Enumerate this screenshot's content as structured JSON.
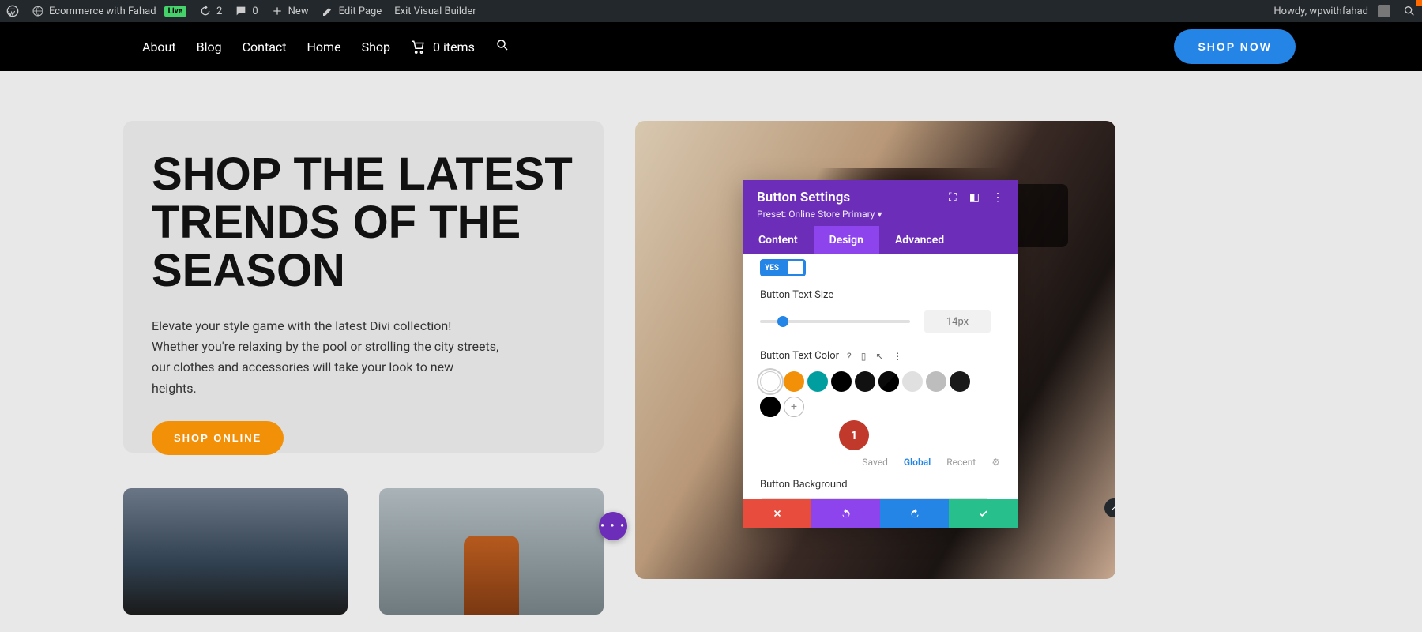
{
  "adminBar": {
    "siteName": "Ecommerce with Fahad",
    "liveBadge": "Live",
    "revisions": "2",
    "comments": "0",
    "newLabel": "New",
    "editPage": "Edit Page",
    "exitBuilder": "Exit Visual Builder",
    "howdy": "Howdy, wpwithfahad"
  },
  "nav": {
    "about": "About",
    "blog": "Blog",
    "contact": "Contact",
    "home": "Home",
    "shop": "Shop",
    "cartItems": "0 items",
    "shopNow": "SHOP NOW"
  },
  "hero": {
    "headline": "SHOP THE LATEST TRENDS OF THE SEASON",
    "body": "Elevate your style game with the latest Divi collection! Whether you're relaxing by the pool or strolling the city streets, our clothes and accessories will take your look to new heights.",
    "cta": "SHOP ONLINE"
  },
  "settings": {
    "title": "Button Settings",
    "preset": "Preset: Online Store Primary ▾",
    "tabs": {
      "content": "Content",
      "design": "Design",
      "advanced": "Advanced"
    },
    "toggleYes": "YES",
    "textSizeLabel": "Button Text Size",
    "textSizeValue": "14px",
    "textColorLabel": "Button Text Color",
    "swatches": [
      {
        "color": "#ffffff",
        "selected": true,
        "border": true
      },
      {
        "color": "#f29008"
      },
      {
        "color": "#009e9e"
      },
      {
        "color": "#000000"
      },
      {
        "color": "#111111"
      },
      {
        "color": "#0a0a0a",
        "half": true
      },
      {
        "color": "#e0e0e0"
      },
      {
        "color": "#bdbdbd"
      },
      {
        "color": "#1a1a1a"
      }
    ],
    "swatches2": [
      {
        "color": "#000000",
        "half": true
      }
    ],
    "redDot": "1",
    "colorTabs": {
      "saved": "Saved",
      "global": "Global",
      "recent": "Recent"
    },
    "bgLabel": "Button Background"
  }
}
